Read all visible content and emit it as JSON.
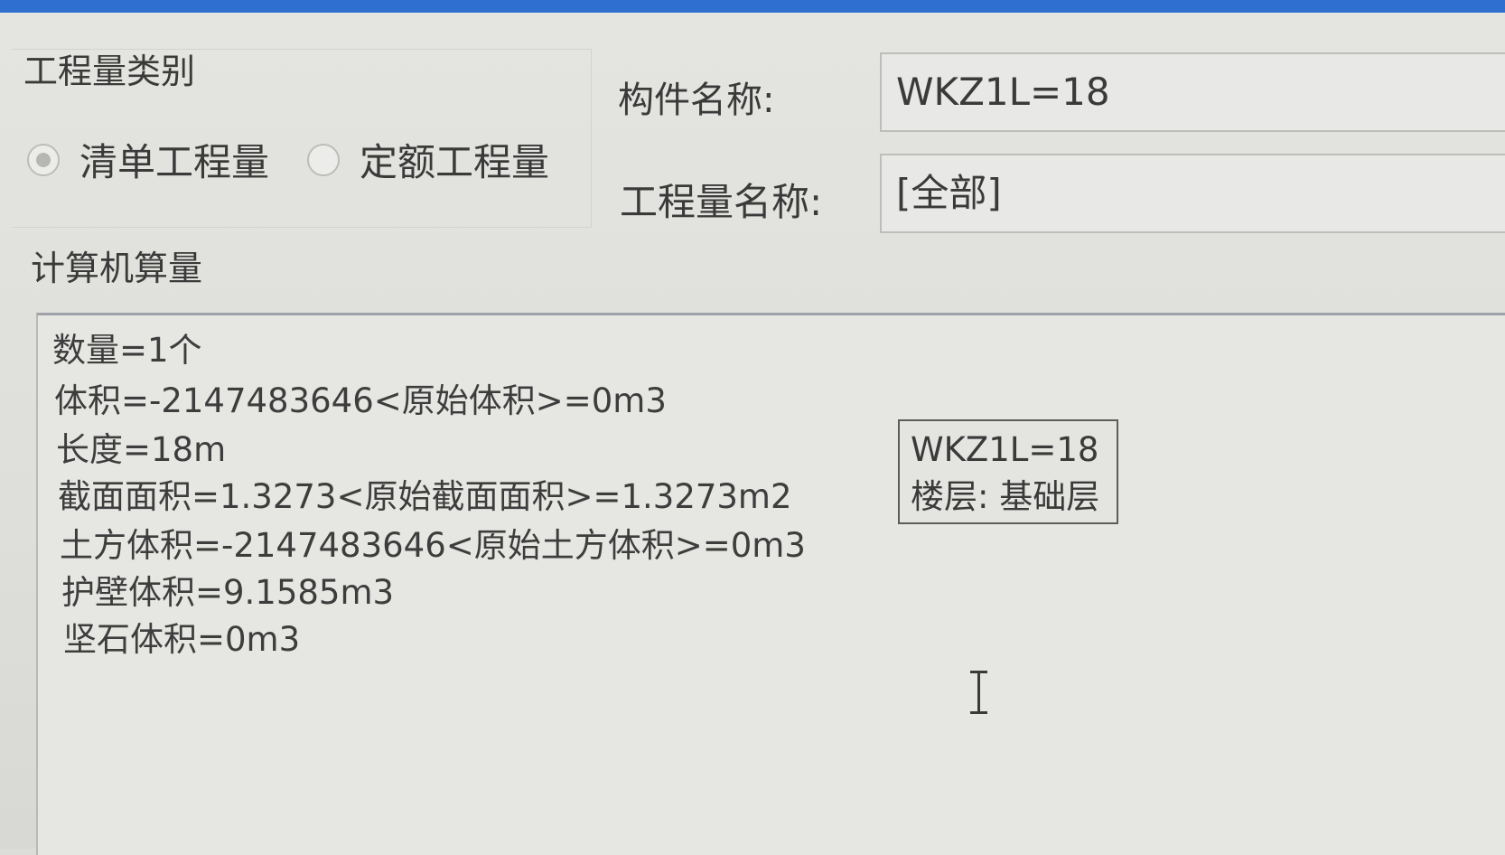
{
  "quantity_type": {
    "title": "工程量类别",
    "options": [
      {
        "label": "清单工程量",
        "selected": true
      },
      {
        "label": "定额工程量",
        "selected": false
      }
    ]
  },
  "component": {
    "label": "构件名称:",
    "value": "WKZ1L=18"
  },
  "quantity_name": {
    "label": "工程量名称:",
    "value": "[全部]"
  },
  "calculation": {
    "title": "计算机算量",
    "lines": [
      "数量=1个",
      "体积=-2147483646<原始体积>=0m3",
      "长度=18m",
      "截面面积=1.3273<原始截面面积>=1.3273m2",
      "土方体积=-2147483646<原始土方体积>=0m3",
      "护壁体积=9.1585m3",
      "坚石体积=0m3"
    ]
  },
  "tooltip": {
    "line1": "WKZ1L=18",
    "line2": "楼层: 基础层"
  },
  "colors": {
    "title_bar": "#2f6fd0",
    "background": "#dcdcd8",
    "text": "#3a3a3a"
  }
}
